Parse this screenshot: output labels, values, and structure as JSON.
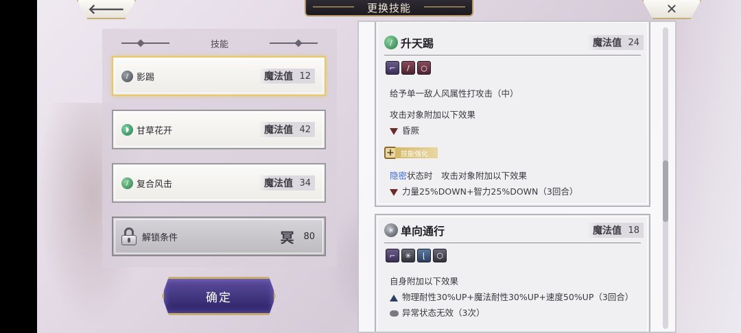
{
  "header": {
    "title": "更换技能",
    "back_glyph": "🡐",
    "close_glyph": "✕"
  },
  "skill_list": {
    "title": "技能",
    "mp_label": "魔法值",
    "items": [
      {
        "name": "影踢",
        "mp": "12",
        "icon": "wind-skill-icon",
        "selected": true
      },
      {
        "name": "甘草花开",
        "mp": "42",
        "icon": "grass-skill-icon",
        "selected": false
      },
      {
        "name": "复合风击",
        "mp": "34",
        "icon": "wind-skill-icon",
        "selected": false
      }
    ],
    "locked": {
      "label": "解锁条件",
      "glyph": "冥",
      "value": "80"
    }
  },
  "confirm_label": "确定",
  "details": {
    "mp_label": "魔法值",
    "cards": [
      {
        "name": "升天踢",
        "mp": "24",
        "desc": "给予单一敌人风属性打攻击（中）",
        "effect_intro": "攻击对象附加以下效果",
        "effect": "昏厥",
        "enhance_label": "技能强化",
        "cond_highlight": "隐密",
        "cond_rest": "状态时　攻击对象附加以下效果",
        "cond_effect": "力量25%DOWN+智力25%DOWN（3回合）"
      },
      {
        "name": "单向通行",
        "mp": "18",
        "effect_intro": "自身附加以下效果",
        "effect_up": "物理耐性30%UP+魔法耐性30%UP+速度50%UP（3回合）",
        "effect_2": "异常状态无效（3次）"
      }
    ]
  },
  "colors": {
    "accent_gold": "#c8ae6a",
    "button_purple": "#3a2e7a",
    "highlight_blue": "#3a6ad8"
  }
}
